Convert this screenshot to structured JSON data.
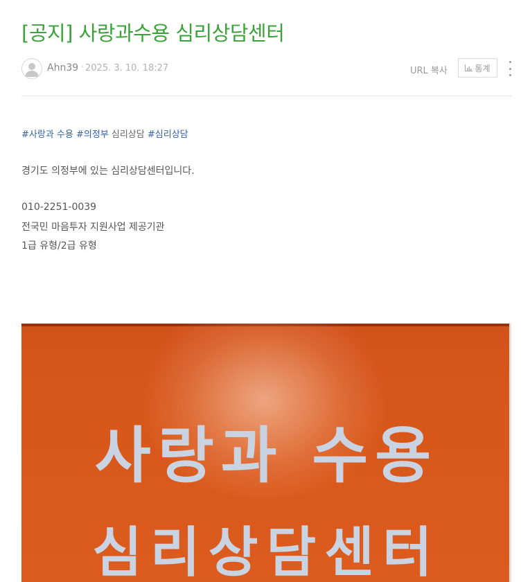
{
  "post": {
    "title": "[공지] 사랑과수용 심리상담센터",
    "author": "Ahn39",
    "separator": "·",
    "date": "2025. 3. 10. 18:27",
    "url_copy_label": "URL 복사",
    "stats_label": "통계"
  },
  "tags": {
    "tag1": "#사랑과 수용",
    "tag2": "#의정부",
    "plain": "심리상담",
    "tag3": "#심리상담"
  },
  "body": {
    "line1": "경기도 의정부에 있는 심리상담센터입니다.",
    "line2": "010-2251-0039",
    "line3": "전국민 마음투자 지원사업 제공기관",
    "line4": "1급 유형/2급 유형"
  },
  "photo": {
    "sign_line1": "사랑과 수용",
    "sign_line2": "심리상담센터"
  },
  "icons": {
    "avatar": "person-icon",
    "stats": "bar-chart-icon",
    "more": "more-vertical-icon"
  },
  "colors": {
    "title": "#3aa33a",
    "tag": "#3365a4",
    "sign_background": "#d8581c",
    "sign_text": "#c9d3e2"
  }
}
